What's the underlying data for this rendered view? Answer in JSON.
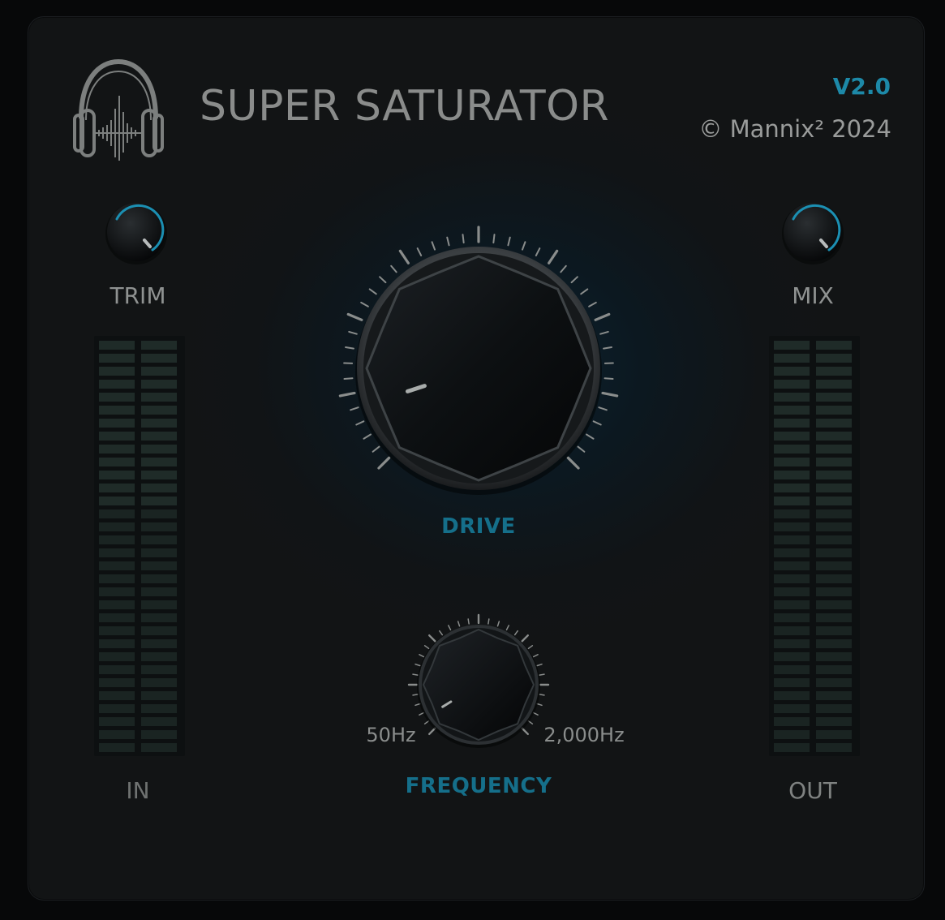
{
  "plugin": {
    "title": "SUPER SATURATOR",
    "version": "V2.0",
    "copyright": "© Mannix² 2024"
  },
  "controls": {
    "trim": {
      "label": "TRIM",
      "value": 0.8
    },
    "mix": {
      "label": "MIX",
      "value": 0.8
    },
    "drive": {
      "label": "DRIVE",
      "value": 0.1
    },
    "frequency": {
      "label": "FREQUENCY",
      "min_label": "50Hz",
      "max_label": "2,000Hz",
      "value": 0.05
    }
  },
  "meters": {
    "input": {
      "label": "IN",
      "level": 0
    },
    "output": {
      "label": "OUT",
      "level": 0
    }
  },
  "colors": {
    "accent": "#1d89a8",
    "label": "#8f9291",
    "background": "#121415"
  },
  "icons": {
    "logo": "headphones-waveform-icon"
  }
}
